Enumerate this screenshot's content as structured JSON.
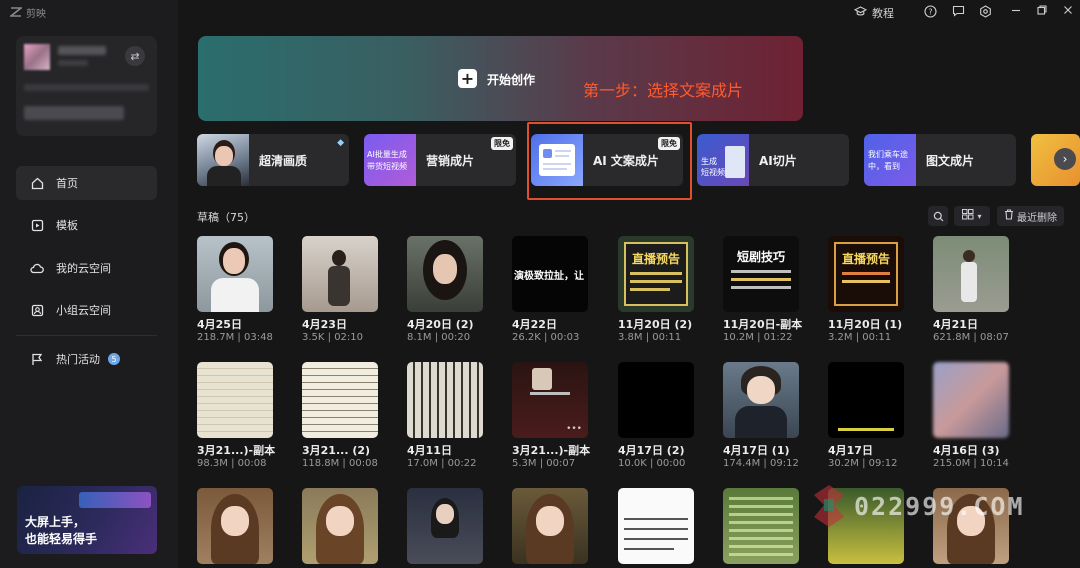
{
  "app": {
    "name": "剪映"
  },
  "topbar": {
    "tutorial_label": "教程"
  },
  "sidebar": {
    "nav": [
      {
        "label": "首页",
        "icon": "home-icon"
      },
      {
        "label": "模板",
        "icon": "template-icon"
      },
      {
        "label": "我的云空间",
        "icon": "cloud-icon"
      },
      {
        "label": "小组云空间",
        "icon": "group-cloud-icon"
      },
      {
        "label": "热门活动",
        "icon": "flag-icon",
        "badge": "5"
      }
    ],
    "promo": {
      "line1": "大屏上手，",
      "line2": "也能轻易得手"
    }
  },
  "hero": {
    "start_label": "开始创作",
    "annotation": "第一步：选择文案成片"
  },
  "tools": [
    {
      "label": "超清画质"
    },
    {
      "label": "营销成片",
      "tag": "限免",
      "thumb_line1": "AI批量生成",
      "thumb_line2": "带货短视频"
    },
    {
      "label": "AI 文案成片",
      "tag": "限免"
    },
    {
      "label": "AI切片",
      "thumb_line1": "生成",
      "thumb_line2": "短视频"
    },
    {
      "label": "图文成片",
      "thumb_line1": "我们乘车途",
      "thumb_line2": "中，看到"
    }
  ],
  "drafts": {
    "title": "草稿（75）",
    "delete_label": "最近删除",
    "items": [
      {
        "name": "4月25日",
        "meta": "218.7M | 03:48"
      },
      {
        "name": "4月23日",
        "meta": "3.5K | 02:10"
      },
      {
        "name": "4月20日 (2)",
        "meta": "8.1M | 00:20"
      },
      {
        "name": "4月22日",
        "meta": "26.2K | 00:03",
        "thumb_text": "演极致拉扯，让"
      },
      {
        "name": "11月20日 (2)",
        "meta": "3.8M | 00:11",
        "thumb_text": "直播预告"
      },
      {
        "name": "11月20日-副本",
        "meta": "10.2M | 01:22",
        "thumb_text": "短剧技巧"
      },
      {
        "name": "11月20日 (1)",
        "meta": "3.2M | 00:11",
        "thumb_text": "直播预告"
      },
      {
        "name": "4月21日",
        "meta": "621.8M | 08:07"
      },
      {
        "name": "3月21...)-副本",
        "meta": "98.3M | 00:08"
      },
      {
        "name": "3月21... (2)",
        "meta": "118.8M | 00:08"
      },
      {
        "name": "4月11日",
        "meta": "17.0M | 00:22"
      },
      {
        "name": "3月21...)-副本",
        "meta": "5.3M | 00:07"
      },
      {
        "name": "4月17日 (2)",
        "meta": "10.0K | 00:00"
      },
      {
        "name": "4月17日 (1)",
        "meta": "174.4M | 09:12"
      },
      {
        "name": "4月17日",
        "meta": "30.2M | 09:12"
      },
      {
        "name": "4月16日 (3)",
        "meta": "215.0M | 10:14"
      },
      {
        "name": "",
        "meta": ""
      },
      {
        "name": "",
        "meta": ""
      },
      {
        "name": "",
        "meta": ""
      },
      {
        "name": "",
        "meta": ""
      },
      {
        "name": "",
        "meta": ""
      },
      {
        "name": "",
        "meta": ""
      },
      {
        "name": "",
        "meta": ""
      },
      {
        "name": "",
        "meta": ""
      }
    ]
  },
  "watermark": {
    "text": "022999.COM"
  },
  "colors": {
    "accent_red": "#e0502c",
    "annotation_text": "#ff5a2e",
    "badge_blue": "#6fa7e6"
  }
}
